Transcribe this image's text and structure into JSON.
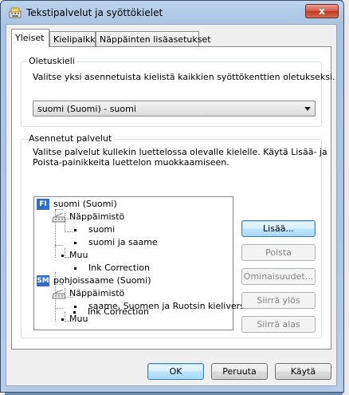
{
  "window": {
    "title": "Tekstipalvelut ja syöttökielet",
    "close_label": "x"
  },
  "tabs": [
    {
      "label": "Yleiset",
      "active": true
    },
    {
      "label": "Kielipalkki",
      "active": false
    },
    {
      "label": "Näppäinten lisäasetukset",
      "active": false
    }
  ],
  "default_language": {
    "group_label": "Oletuskieli",
    "description": "Valitse yksi asennetuista kielistä kaikkien syöttökenttien oletukseksi.",
    "selected": "suomi (Suomi) - suomi"
  },
  "installed_services": {
    "group_label": "Asennetut palvelut",
    "description_line1": "Valitse palvelut kullekin luettelossa olevalle kielelle. Käytä Lisää- ja",
    "description_line2": "Poista-painikkeita luettelon muokkaamiseen.",
    "tree": {
      "lang1": {
        "code": "FI",
        "label": "suomi (Suomi)"
      },
      "lang1_keyboard": "Näppäimistö",
      "lang1_kb_item1": "suomi",
      "lang1_kb_item2": "suomi ja saame",
      "lang1_other": "Muu",
      "lang1_other_item1": "Ink Correction",
      "lang2": {
        "code": "SM",
        "label": "pohjoissaame (Suomi)"
      },
      "lang2_keyboard": "Näppäimistö",
      "lang2_kb_item1": "saame, Suomen ja Ruotsin kieliversiot",
      "lang2_other": "Muu",
      "lang2_other_item1": "Ink Correction"
    },
    "buttons": {
      "add": "Lisää...",
      "remove": "Poista",
      "properties": "Ominaisuudet...",
      "move_up": "Siirrä ylös",
      "move_down": "Siirrä alas"
    }
  },
  "footer": {
    "ok": "OK",
    "cancel": "Peruuta",
    "apply": "Käytä"
  },
  "colors": {
    "accent": "#2f6fc6",
    "close_red": "#c03a22"
  }
}
